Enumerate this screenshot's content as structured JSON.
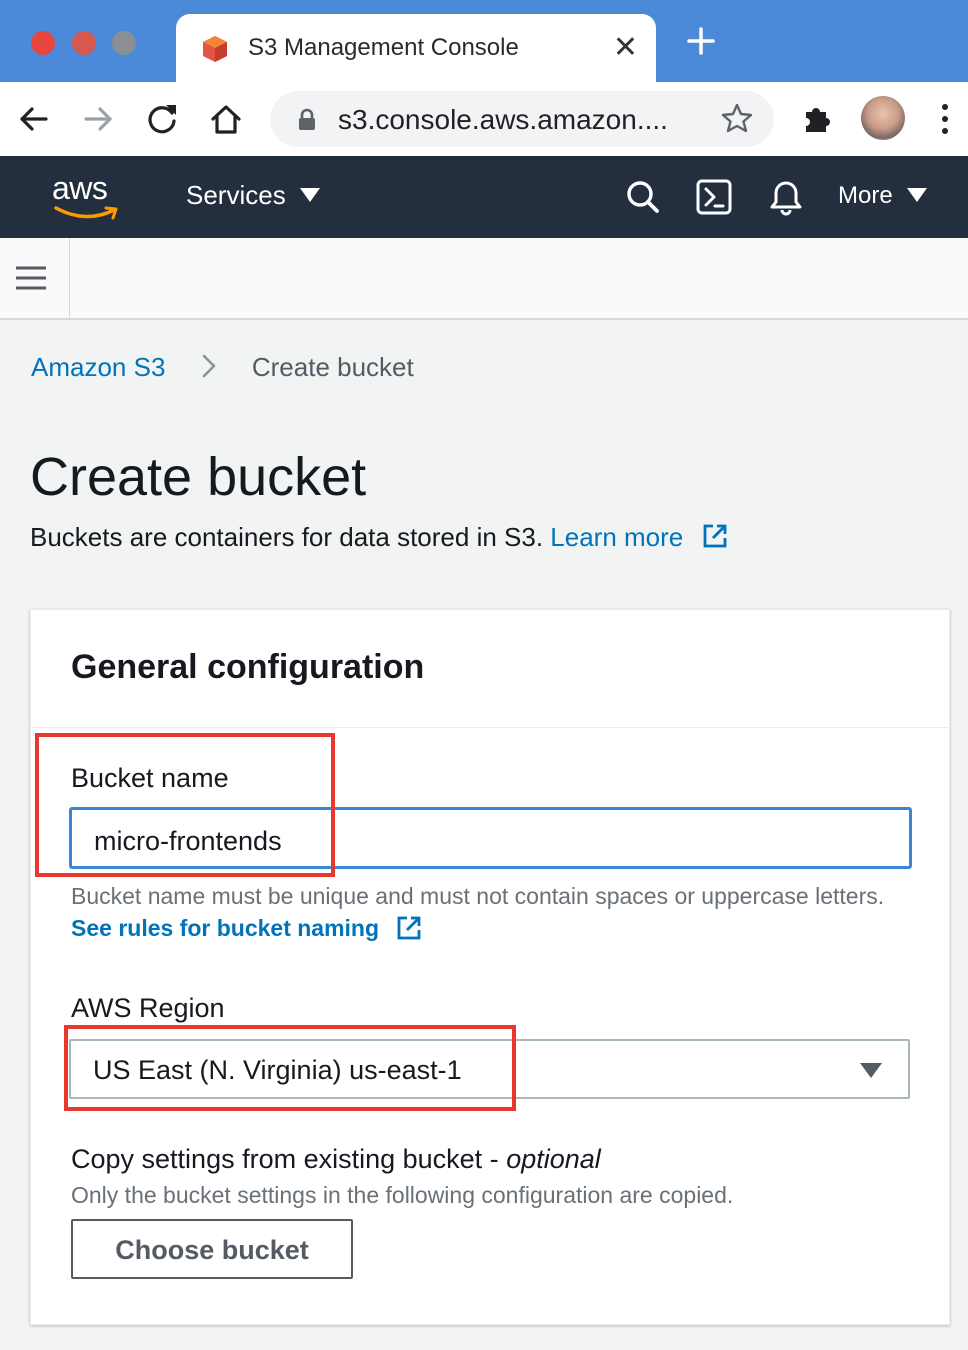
{
  "browser": {
    "tab_title": "S3 Management Console",
    "url": "s3.console.aws.amazon...."
  },
  "aws_nav": {
    "logo_text": "aws",
    "services_label": "Services",
    "more_label": "More"
  },
  "breadcrumb": {
    "root": "Amazon S3",
    "current": "Create bucket"
  },
  "page": {
    "title": "Create bucket",
    "description": "Buckets are containers for data stored in S3.",
    "learn_more": "Learn more"
  },
  "general_config": {
    "title": "General configuration",
    "bucket_name_label": "Bucket name",
    "bucket_name_value": "micro-frontends",
    "bucket_name_hint": "Bucket name must be unique and must not contain spaces or uppercase letters.",
    "bucket_name_rules_link": "See rules for bucket naming",
    "region_label": "AWS Region",
    "region_value": "US East (N. Virginia) us-east-1",
    "copy_label": "Copy settings from existing bucket - ",
    "copy_optional": "optional",
    "copy_desc": "Only the bucket settings in the following configuration are copied.",
    "choose_bucket_button": "Choose bucket"
  },
  "colors": {
    "aws_nav_bg": "#232f3e",
    "link": "#0073bb",
    "input_focus": "#3a86d6",
    "highlight": "#e8372e",
    "tabstrip": "#4a8ad8"
  }
}
